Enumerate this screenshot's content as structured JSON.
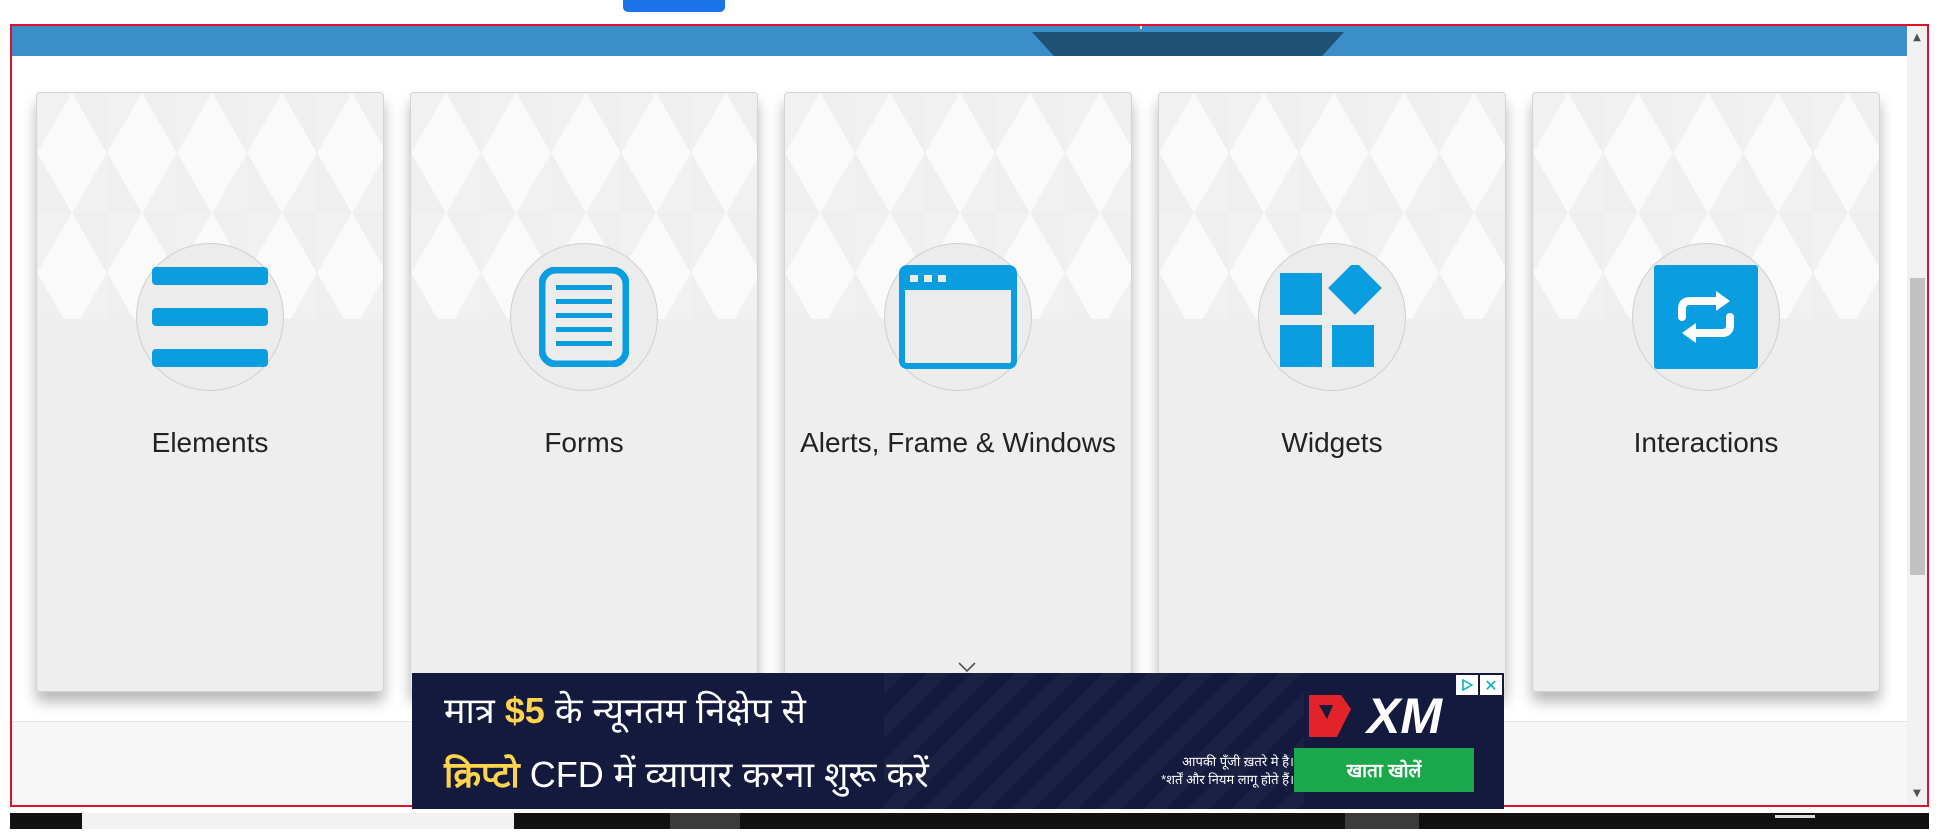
{
  "cards": [
    {
      "title": "Elements",
      "icon": "menu-bars-icon"
    },
    {
      "title": "Forms",
      "icon": "document-lines-icon"
    },
    {
      "title": "Alerts, Frame & Windows",
      "icon": "browser-window-icon"
    },
    {
      "title": "Widgets",
      "icon": "widgets-blocks-icon"
    },
    {
      "title": "Interactions",
      "icon": "swap-arrows-icon"
    }
  ],
  "ad": {
    "line1_text": "मात्र",
    "line1_price": "$5",
    "line1_rest": "के न्यूनतम निक्षेप से",
    "line2_crypto": "क्रिप्टो",
    "line2_rest": "CFD में व्यापार करना शुरू करें",
    "disclaimer_1": "आपकी पूँजी ख़तरे मे है।",
    "disclaimer_2": "*शर्तें और नियम लागू होते हैं।",
    "cta": "खाता खोलें",
    "brand": "XM",
    "close_glyph": "✕"
  },
  "colors": {
    "accent": "#0a9ee0",
    "header": "#3b8ec7",
    "frame_border": "#e0112b",
    "ad_bg": "#141a3d",
    "cta_bg": "#1ba84a"
  }
}
